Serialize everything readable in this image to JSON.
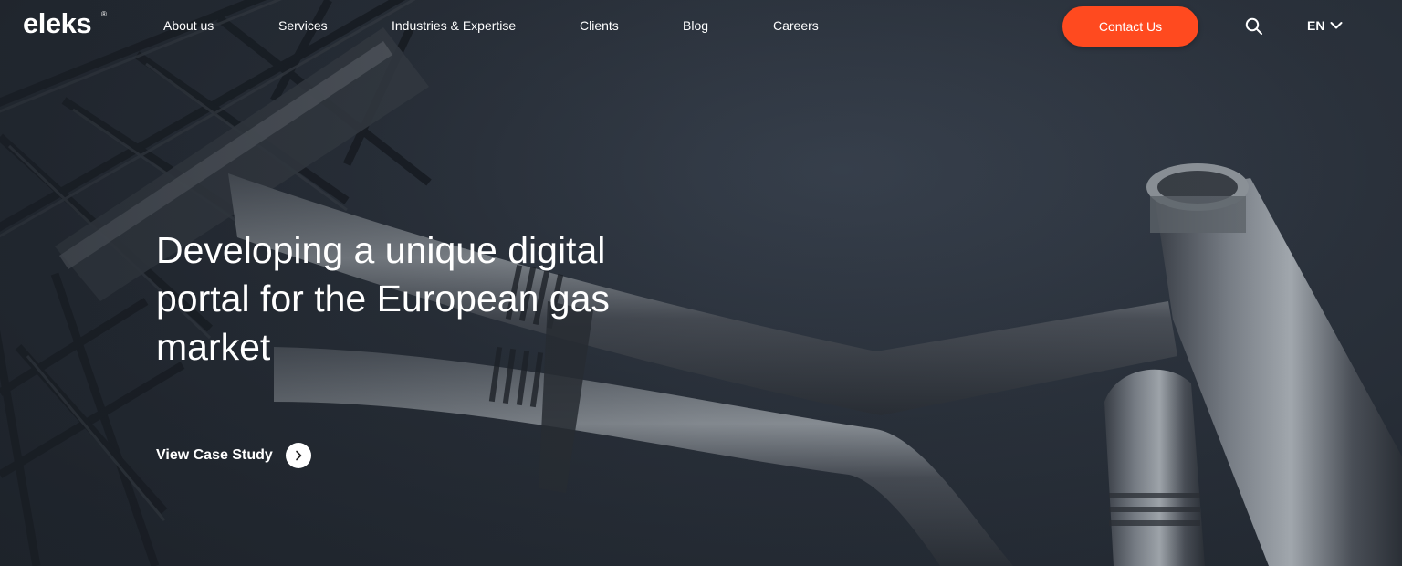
{
  "header": {
    "logo_text": "eleks",
    "logo_mark": "®",
    "nav": [
      {
        "label": "About us"
      },
      {
        "label": "Services"
      },
      {
        "label": "Industries & Expertise"
      },
      {
        "label": "Clients"
      },
      {
        "label": "Blog"
      },
      {
        "label": "Careers"
      }
    ],
    "contact_label": "Contact Us",
    "search_icon": "search-icon",
    "language": "EN"
  },
  "hero": {
    "headline": "Developing a unique digital portal for the European gas market",
    "cta_label": "View Case Study",
    "cta_icon": "chevron-right-icon"
  },
  "colors": {
    "accent": "#ff4a1f",
    "background": "#262d37",
    "text": "#ffffff"
  }
}
